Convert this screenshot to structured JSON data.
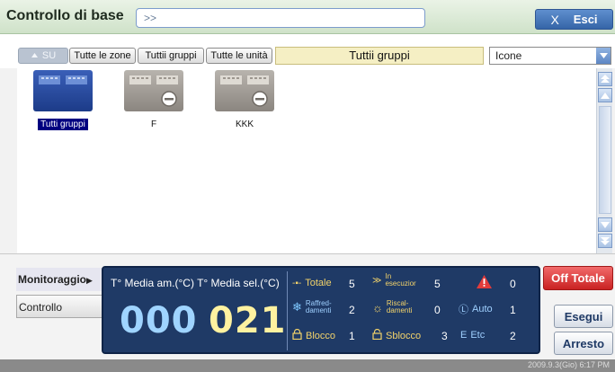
{
  "header": {
    "title": "Controllo di base",
    "path": ">>",
    "exit_icon": "X",
    "exit_label": "Esci"
  },
  "toolbar": {
    "up_label": "SU",
    "buttons": [
      "Tutte le zone",
      "Tuttii gruppi",
      "Tutte le unità"
    ],
    "group_title": "Tuttii gruppi",
    "view_mode": "Icone"
  },
  "units": [
    {
      "name": "Tutti gruppi",
      "selected": true
    },
    {
      "name": "F",
      "selected": false
    },
    {
      "name": "KKK",
      "selected": false
    }
  ],
  "tabs": {
    "monitor": "Monitoraggio",
    "control": "Controllo"
  },
  "panel": {
    "avg_amb_label": "T° Media am.(°C)",
    "avg_set_label": "T° Media sel.(°C)",
    "avg_amb_value": "000",
    "avg_set_value": "021",
    "totale_label": "Totale",
    "totale_value": "5",
    "in_esecuzione_label_1": "In",
    "in_esecuzione_label_2": "esecuzior",
    "in_esecuzione_value": "5",
    "alarm_value": "0",
    "raffred_label_1": "Raffred-",
    "raffred_label_2": "damenti",
    "raffred_value": "2",
    "riscal_label_1": "Riscal-",
    "riscal_label_2": "damenti",
    "riscal_value": "0",
    "auto_label": "Auto",
    "auto_value": "1",
    "blocco_label": "Blocco",
    "blocco_value": "1",
    "sblocco_label": "Sblocco",
    "sblocco_value": "3",
    "etc_prefix": "E",
    "etc_label": "Etc",
    "etc_value": "2"
  },
  "actions": {
    "off_total": "Off Totale",
    "execute": "Esegui",
    "stop": "Arresto"
  },
  "status": {
    "datetime": "2009.9.3(Gio)  6:17 PM"
  },
  "colors": {
    "accent": "#3565a7",
    "panel_bg": "#1f3a66",
    "off_total": "#c92222",
    "title_bar": "#cfe2c9"
  }
}
